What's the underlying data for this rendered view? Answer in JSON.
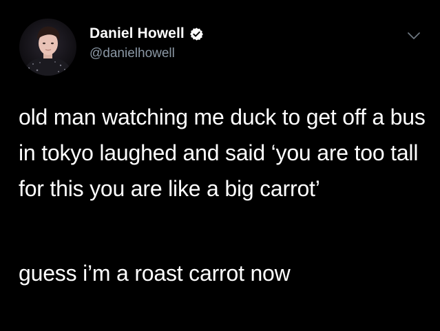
{
  "tweet": {
    "author": {
      "display_name": "Daniel Howell",
      "handle": "@danielhowell",
      "verified": true
    },
    "icons": {
      "verified": "verified-badge-icon",
      "menu": "chevron-down-icon"
    },
    "text": {
      "paragraph_1": "old man watching me duck to get off a bus in tokyo laughed and said ‘you are too tall for this you are like a big carrot’",
      "paragraph_2": "guess i’m a roast carrot now"
    }
  },
  "colors": {
    "background": "#000000",
    "text": "#ffffff",
    "handle": "#8b98a5"
  }
}
